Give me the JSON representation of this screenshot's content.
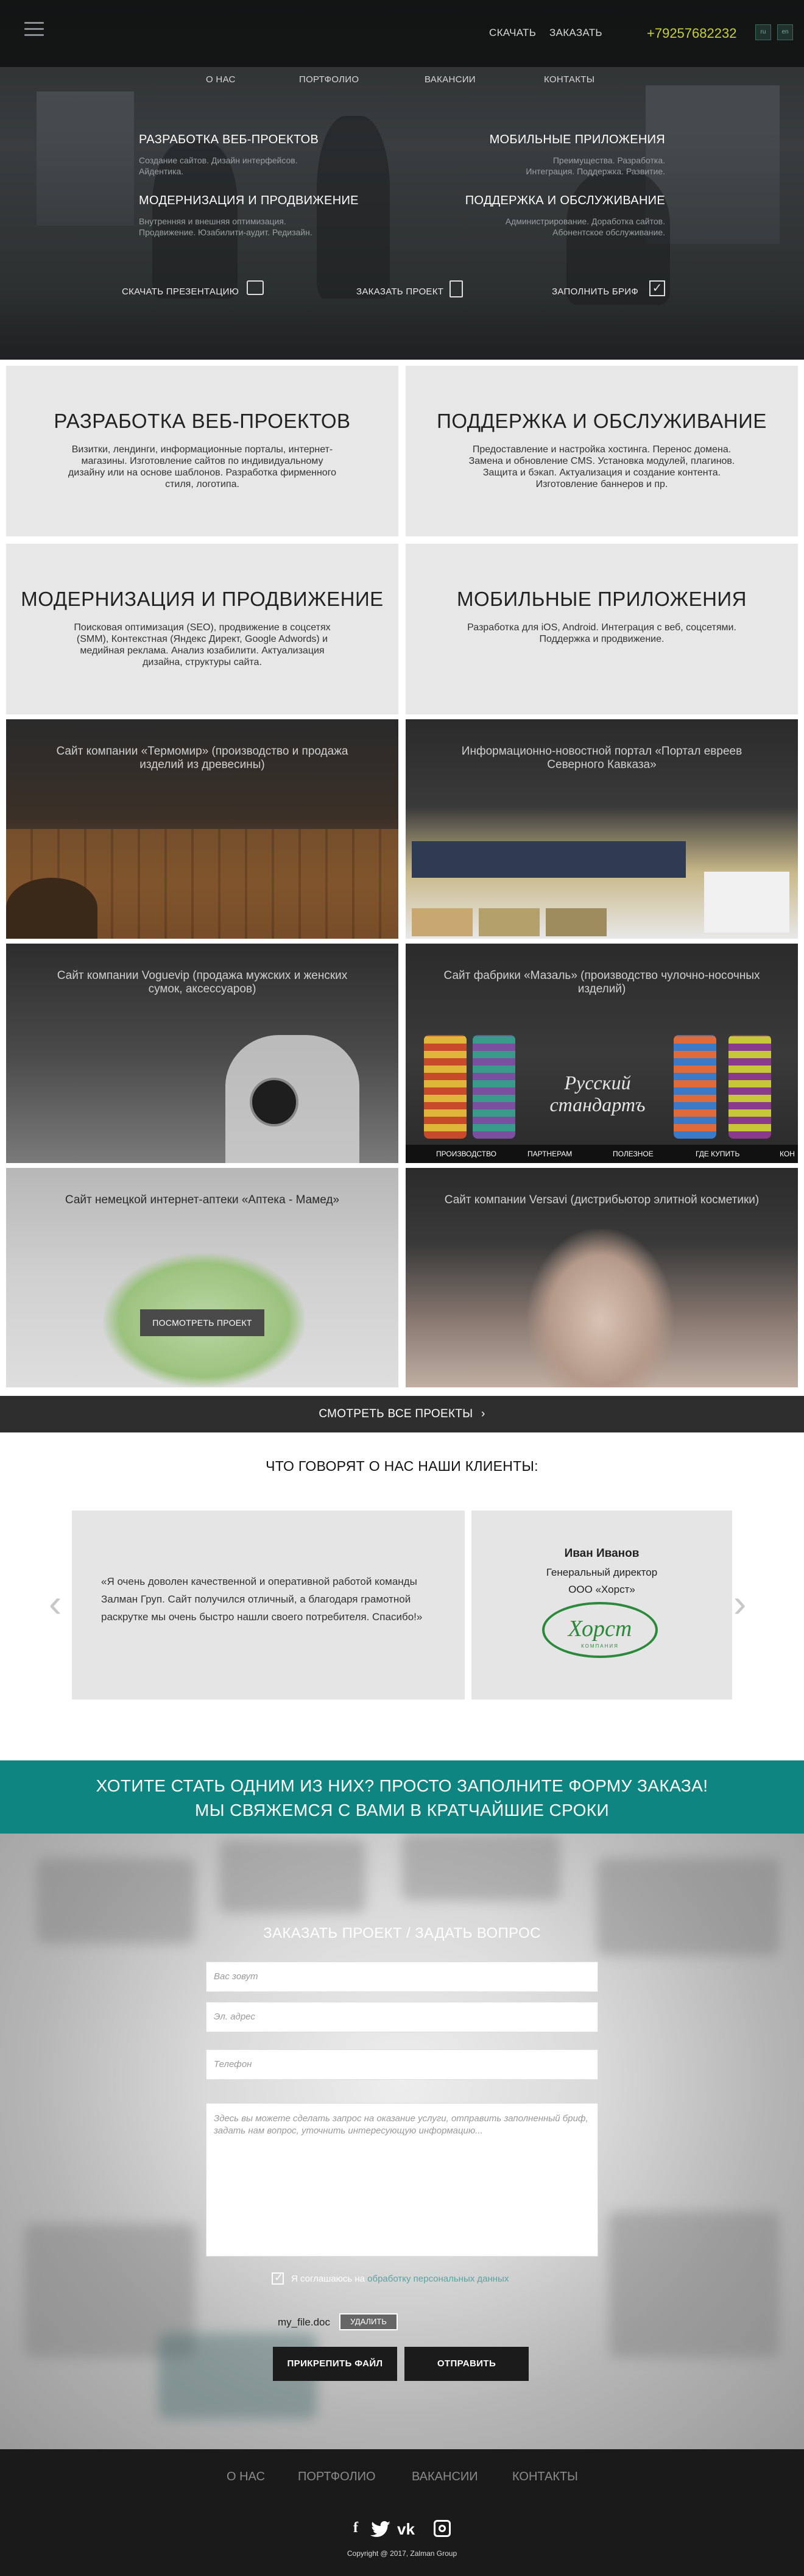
{
  "header": {
    "download": "СКАЧАТЬ",
    "order": "ЗАКАЗАТЬ",
    "phone": "+79257682232",
    "lang": [
      "ru",
      "en"
    ]
  },
  "nav": [
    "О НАС",
    "ПОРТФОЛИО",
    "ВАКАНСИИ",
    "КОНТАКТЫ"
  ],
  "hero": {
    "services": [
      {
        "title": "РАЗРАБОТКА ВЕБ-ПРОЕКТОВ",
        "desc1": "Создание сайтов. Дизайн интерфейсов.",
        "desc2": "Айдентика."
      },
      {
        "title": "МОБИЛЬНЫЕ ПРИЛОЖЕНИЯ",
        "desc1": "Преимущества. Разработка.",
        "desc2": "Интеграция. Поддержка. Развитие."
      },
      {
        "title": "МОДЕРНИЗАЦИЯ И ПРОДВИЖЕНИЕ",
        "desc1": "Внутренняя и внешняя оптимизация.",
        "desc2": "Продвижение. Юзабилити-аудит. Редизайн."
      },
      {
        "title": "ПОДДЕРЖКА И ОБСЛУЖИВАНИЕ",
        "desc1": "Администрирование. Доработка сайтов.",
        "desc2": "Абонентское обслуживание."
      }
    ],
    "actions": [
      "СКАЧАТЬ ПРЕЗЕНТАЦИЮ",
      "ЗАКАЗАТЬ ПРОЕКТ",
      "ЗАПОЛНИТЬ БРИФ"
    ]
  },
  "tiles": [
    {
      "title": "РАЗРАБОТКА ВЕБ-ПРОЕКТОВ",
      "text": "Визитки, лендинги, информационные порталы, интернет-магазины. Изготовление сайтов по индивидуальному дизайну или на основе шаблонов. Разработка фирменного стиля, логотипа."
    },
    {
      "title": "ПОДДЕРЖКА И ОБСЛУЖИВАНИЕ",
      "text": "Предоставление и настройка хостинга. Перенос домена. Замена и обновление CMS. Установка модулей, плагинов. Защита и бэкап. Актуализация и создание контента. Изготовление баннеров и пр."
    },
    {
      "title": "МОДЕРНИЗАЦИЯ И ПРОДВИЖЕНИЕ",
      "text": "Поисковая оптимизация (SEO), продвижение в соцсетях (SMM), Контекстная (Яндекс Директ, Google Adwords) и медийная реклама. Анализ юзабилити. Актуализация дизайна, структуры сайта."
    },
    {
      "title": "МОБИЛЬНЫЕ ПРИЛОЖЕНИЯ",
      "text": "Разработка для iOS, Android. Интеграция с веб, соцсетями. Поддержка и продвижение."
    }
  ],
  "portfolio": {
    "items": [
      "Сайт компании «Термомир» (производство и продажа изделий из древесины)",
      "Информационно-новостной портал «Портал евреев Северного Кавказа»",
      "Сайт компании Voguevip (продажа мужских и женских сумок, аксессуаров)",
      "Сайт фабрики «Мазаль» (производство чулочно-носочных изделий)",
      "Сайт немецкой интернет-аптеки «Аптека - Мамед»",
      "Сайт компании Versavi (дистрибьютор элитной косметики)"
    ],
    "view_button": "ПОСМОТРЕТЬ ПРОЕКТ",
    "socks_brand": "Русский стандартъ",
    "socks_menu": [
      "ПРОИЗВОДСТВО",
      "ПАРТНЕРАМ",
      "ПОЛЕЗНОЕ",
      "ГДЕ КУПИТЬ",
      "КОН"
    ],
    "all_projects": "СМОТРЕТЬ ВСЕ ПРОЕКТЫ"
  },
  "testimonials": {
    "heading": "ЧТО ГОВОРЯТ О НАС НАШИ КЛИЕНТЫ:",
    "quote": "«Я очень доволен качественной и оперативной работой команды Залман Груп. Сайт получился отличный, а благодаря грамотной раскрутке мы очень быстро нашли своего потребителя. Спасибо!»",
    "name": "Иван Иванов",
    "role": "Генеральный директор",
    "company": "ООО «Хорст»",
    "logo_text": "Хорст",
    "logo_sub": "КОМПАНИЯ"
  },
  "cta": {
    "line1": "ХОТИТЕ СТАТЬ ОДНИМ ИЗ НИХ?  ПРОСТО ЗАПОЛНИТЕ ФОРМУ ЗАКАЗА!",
    "line2": "МЫ СВЯЖЕМСЯ С ВАМИ В КРАТЧАЙШИЕ СРОКИ"
  },
  "form": {
    "title": "ЗАКАЗАТЬ ПРОЕКТ / ЗАДАТЬ ВОПРОС",
    "name_ph": "Вас зовут",
    "email_ph": "Эл. адрес",
    "phone_ph": "Телефон",
    "message_ph": "Здесь вы можете сделать запрос на оказание услуги, отправить заполненный бриф, задать нам вопрос, уточнить интересующую информацию...",
    "agree_prefix": "Я соглашаюсь на",
    "agree_link": "обработку персональных данных",
    "file_name": "my_file.doc",
    "delete": "УДАЛИТЬ",
    "attach": "ПРИКРЕПИТЬ ФАЙЛ",
    "send": "ОТПРАВИТЬ"
  },
  "footer": {
    "copyright": "Copyright @ 2017, Zalman Group"
  },
  "colors": {
    "accent_teal": "#0f8582",
    "phone": "#c7cf3a",
    "footer_bg": "#1a1a1a"
  }
}
